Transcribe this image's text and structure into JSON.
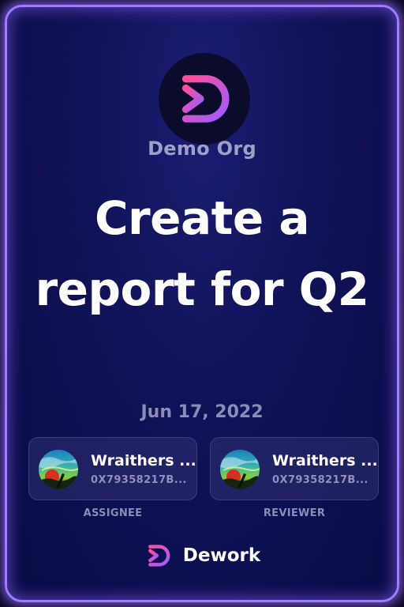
{
  "org": {
    "name": "Demo Org",
    "logo_icon": "dework-logo-icon"
  },
  "task": {
    "title": "Create a report for Q2",
    "date": "Jun 17, 2022"
  },
  "assignee": {
    "name": "Wraithers ...",
    "address": "0X79358217B...",
    "role_label": "ASSIGNEE",
    "avatar_icon": "avatar-image"
  },
  "reviewer": {
    "name": "Wraithers ...",
    "address": "0X79358217B...",
    "role_label": "REVIEWER",
    "avatar_icon": "avatar-image"
  },
  "brand": {
    "name": "Dework",
    "logo_icon": "dework-logo-icon"
  },
  "colors": {
    "border_glow": "#9f7bff",
    "background": "#0f1256",
    "logo_gradient_start": "#ff4f9a",
    "logo_gradient_end": "#9b5cff"
  }
}
